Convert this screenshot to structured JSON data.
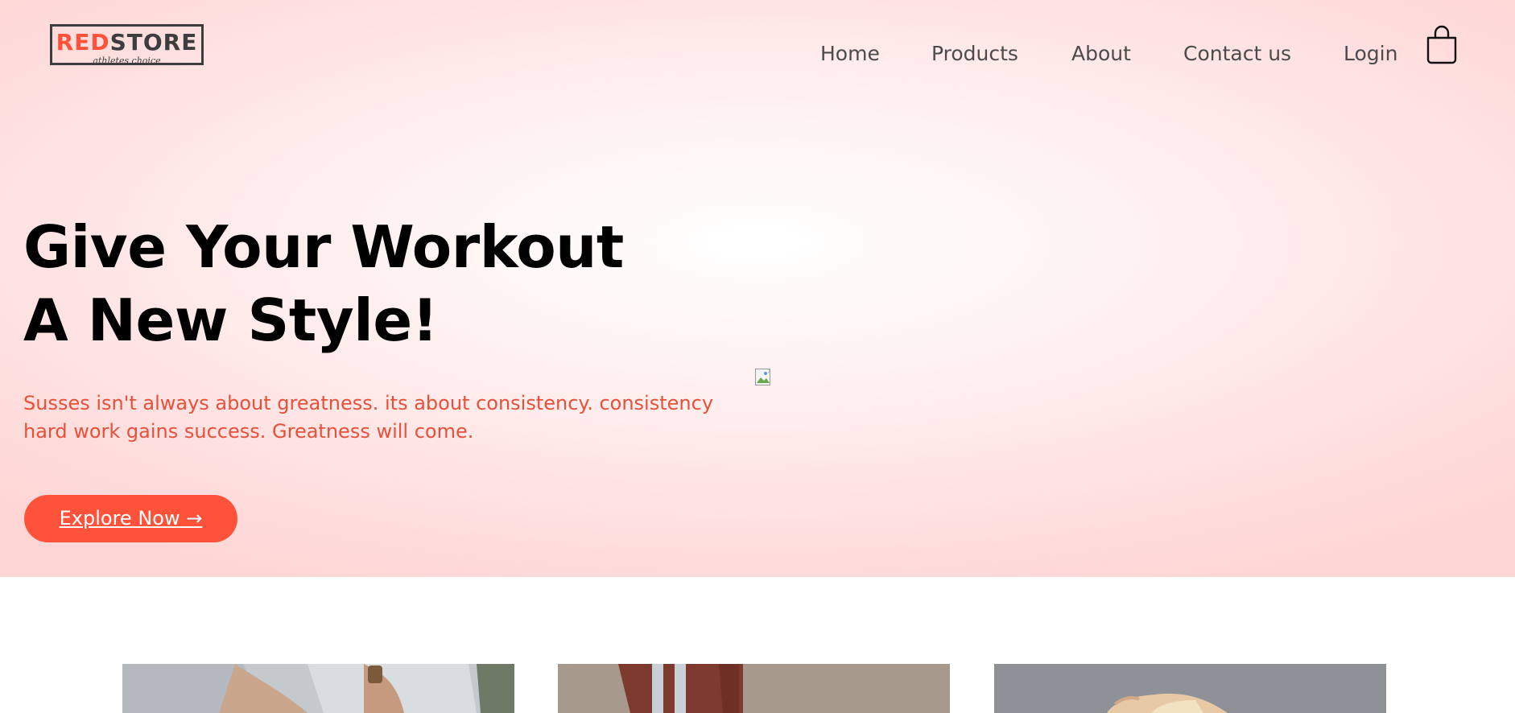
{
  "logo": {
    "red_text": "RED",
    "dark_text": "STORE",
    "tagline": "athletes choice"
  },
  "nav": {
    "items": [
      {
        "label": "Home"
      },
      {
        "label": "Products"
      },
      {
        "label": "About"
      },
      {
        "label": "Contact us"
      },
      {
        "label": "Login"
      }
    ],
    "cart_icon": "shopping-bag-icon"
  },
  "hero": {
    "title_line1": "Give Your Workout",
    "title_line2": "A New Style!",
    "subtitle": "Susses isn't always about greatness. its about consistency. consistency hard work gains success. Greatness will come.",
    "button_label": "Explore Now →",
    "image_icon": "broken-image-icon"
  },
  "categories": [
    {
      "name": "category-image-1"
    },
    {
      "name": "category-image-2"
    },
    {
      "name": "category-image-3"
    }
  ],
  "colors": {
    "accent": "#ff523b",
    "hero_bg": "#ffd6d6",
    "text_dark": "#000000",
    "nav_text": "#4b4b4b"
  }
}
